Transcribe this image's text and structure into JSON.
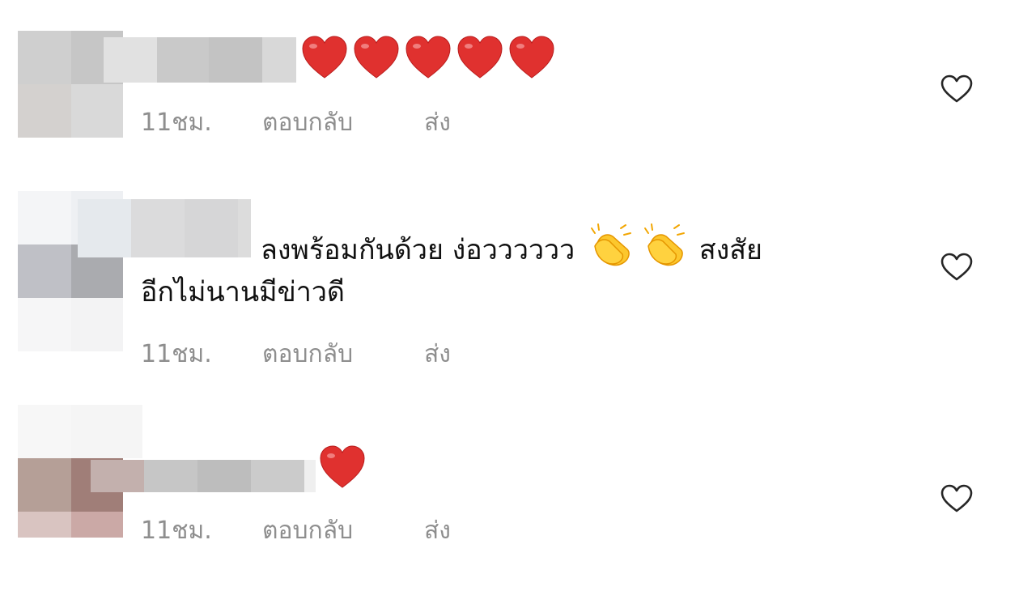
{
  "comments": [
    {
      "text": "",
      "emojis": [
        "heart-emoji",
        "heart-emoji",
        "heart-emoji",
        "heart-emoji",
        "heart-emoji"
      ],
      "time": "11ชม.",
      "reply": "ตอบกลับ",
      "send": "ส่ง"
    },
    {
      "text_line1": "ลงพร้อมกันด้วย ง่อวววววว",
      "text_line1_tail": "สงสัย",
      "text_line2": "อีกไม่นานมีข่าวดี",
      "emojis": [
        "clap-emoji",
        "clap-emoji"
      ],
      "time": "11ชม.",
      "reply": "ตอบกลับ",
      "send": "ส่ง"
    },
    {
      "text": "",
      "emojis": [
        "heart-emoji"
      ],
      "time": "11ชม.",
      "reply": "ตอบกลับ",
      "send": "ส่ง"
    }
  ],
  "colors": {
    "meta": "#8e8e8e",
    "heart": "#e0312f",
    "like_outline": "#262626"
  }
}
